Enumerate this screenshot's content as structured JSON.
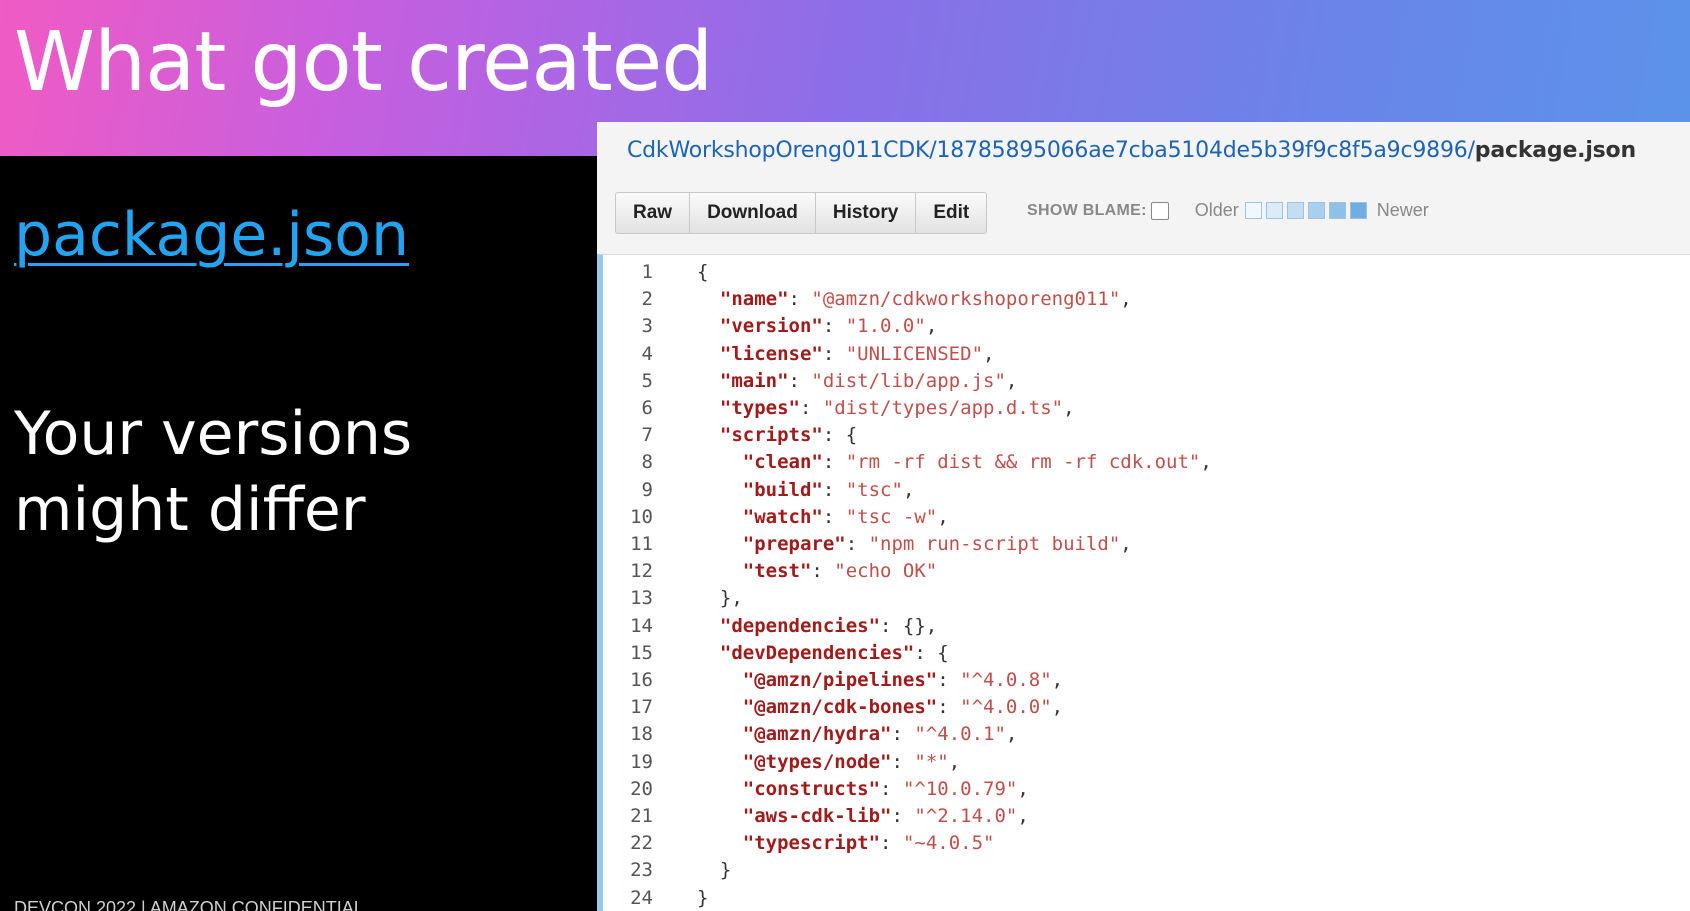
{
  "slide": {
    "title": "What got created",
    "link": "package.json",
    "note_line1": "Your versions",
    "note_line2": "might differ",
    "footer": "DEVCON 2022 | AMAZON CONFIDENTIAL"
  },
  "viewer": {
    "path_prefix": "CdkWorkshopOreng011CDK/18785895066ae7cba5104de5b39f9c8f5a9c9896/",
    "path_file": "package.json",
    "buttons": [
      "Raw",
      "Download",
      "History",
      "Edit"
    ],
    "show_blame_label": "SHOW BLAME:",
    "older_label": "Older",
    "newer_label": "Newer",
    "blame_swatch_colors": [
      "#f0f7fd",
      "#dcebf8",
      "#c3ddf3",
      "#a9cfee",
      "#8ec0e8",
      "#6faee2"
    ]
  },
  "code": [
    [
      {
        "t": "p",
        "v": "{"
      }
    ],
    [
      {
        "t": "p",
        "v": "  "
      },
      {
        "t": "k",
        "v": "\"name\""
      },
      {
        "t": "p",
        "v": ": "
      },
      {
        "t": "s",
        "v": "\"@amzn/cdkworkshoporeng011\""
      },
      {
        "t": "p",
        "v": ","
      }
    ],
    [
      {
        "t": "p",
        "v": "  "
      },
      {
        "t": "k",
        "v": "\"version\""
      },
      {
        "t": "p",
        "v": ": "
      },
      {
        "t": "s",
        "v": "\"1.0.0\""
      },
      {
        "t": "p",
        "v": ","
      }
    ],
    [
      {
        "t": "p",
        "v": "  "
      },
      {
        "t": "k",
        "v": "\"license\""
      },
      {
        "t": "p",
        "v": ": "
      },
      {
        "t": "s",
        "v": "\"UNLICENSED\""
      },
      {
        "t": "p",
        "v": ","
      }
    ],
    [
      {
        "t": "p",
        "v": "  "
      },
      {
        "t": "k",
        "v": "\"main\""
      },
      {
        "t": "p",
        "v": ": "
      },
      {
        "t": "s",
        "v": "\"dist/lib/app.js\""
      },
      {
        "t": "p",
        "v": ","
      }
    ],
    [
      {
        "t": "p",
        "v": "  "
      },
      {
        "t": "k",
        "v": "\"types\""
      },
      {
        "t": "p",
        "v": ": "
      },
      {
        "t": "s",
        "v": "\"dist/types/app.d.ts\""
      },
      {
        "t": "p",
        "v": ","
      }
    ],
    [
      {
        "t": "p",
        "v": "  "
      },
      {
        "t": "k",
        "v": "\"scripts\""
      },
      {
        "t": "p",
        "v": ": {"
      }
    ],
    [
      {
        "t": "p",
        "v": "    "
      },
      {
        "t": "k",
        "v": "\"clean\""
      },
      {
        "t": "p",
        "v": ": "
      },
      {
        "t": "s",
        "v": "\"rm -rf dist && rm -rf cdk.out\""
      },
      {
        "t": "p",
        "v": ","
      }
    ],
    [
      {
        "t": "p",
        "v": "    "
      },
      {
        "t": "k",
        "v": "\"build\""
      },
      {
        "t": "p",
        "v": ": "
      },
      {
        "t": "s",
        "v": "\"tsc\""
      },
      {
        "t": "p",
        "v": ","
      }
    ],
    [
      {
        "t": "p",
        "v": "    "
      },
      {
        "t": "k",
        "v": "\"watch\""
      },
      {
        "t": "p",
        "v": ": "
      },
      {
        "t": "s",
        "v": "\"tsc -w\""
      },
      {
        "t": "p",
        "v": ","
      }
    ],
    [
      {
        "t": "p",
        "v": "    "
      },
      {
        "t": "k",
        "v": "\"prepare\""
      },
      {
        "t": "p",
        "v": ": "
      },
      {
        "t": "s",
        "v": "\"npm run-script build\""
      },
      {
        "t": "p",
        "v": ","
      }
    ],
    [
      {
        "t": "p",
        "v": "    "
      },
      {
        "t": "k",
        "v": "\"test\""
      },
      {
        "t": "p",
        "v": ": "
      },
      {
        "t": "s",
        "v": "\"echo OK\""
      }
    ],
    [
      {
        "t": "p",
        "v": "  },"
      }
    ],
    [
      {
        "t": "p",
        "v": "  "
      },
      {
        "t": "k",
        "v": "\"dependencies\""
      },
      {
        "t": "p",
        "v": ": {},"
      }
    ],
    [
      {
        "t": "p",
        "v": "  "
      },
      {
        "t": "k",
        "v": "\"devDependencies\""
      },
      {
        "t": "p",
        "v": ": {"
      }
    ],
    [
      {
        "t": "p",
        "v": "    "
      },
      {
        "t": "k",
        "v": "\"@amzn/pipelines\""
      },
      {
        "t": "p",
        "v": ": "
      },
      {
        "t": "s",
        "v": "\"^4.0.8\""
      },
      {
        "t": "p",
        "v": ","
      }
    ],
    [
      {
        "t": "p",
        "v": "    "
      },
      {
        "t": "k",
        "v": "\"@amzn/cdk-bones\""
      },
      {
        "t": "p",
        "v": ": "
      },
      {
        "t": "s",
        "v": "\"^4.0.0\""
      },
      {
        "t": "p",
        "v": ","
      }
    ],
    [
      {
        "t": "p",
        "v": "    "
      },
      {
        "t": "k",
        "v": "\"@amzn/hydra\""
      },
      {
        "t": "p",
        "v": ": "
      },
      {
        "t": "s",
        "v": "\"^4.0.1\""
      },
      {
        "t": "p",
        "v": ","
      }
    ],
    [
      {
        "t": "p",
        "v": "    "
      },
      {
        "t": "k",
        "v": "\"@types/node\""
      },
      {
        "t": "p",
        "v": ": "
      },
      {
        "t": "s",
        "v": "\"*\""
      },
      {
        "t": "p",
        "v": ","
      }
    ],
    [
      {
        "t": "p",
        "v": "    "
      },
      {
        "t": "k",
        "v": "\"constructs\""
      },
      {
        "t": "p",
        "v": ": "
      },
      {
        "t": "s",
        "v": "\"^10.0.79\""
      },
      {
        "t": "p",
        "v": ","
      }
    ],
    [
      {
        "t": "p",
        "v": "    "
      },
      {
        "t": "k",
        "v": "\"aws-cdk-lib\""
      },
      {
        "t": "p",
        "v": ": "
      },
      {
        "t": "s",
        "v": "\"^2.14.0\""
      },
      {
        "t": "p",
        "v": ","
      }
    ],
    [
      {
        "t": "p",
        "v": "    "
      },
      {
        "t": "k",
        "v": "\"typescript\""
      },
      {
        "t": "p",
        "v": ": "
      },
      {
        "t": "s",
        "v": "\"~4.0.5\""
      }
    ],
    [
      {
        "t": "p",
        "v": "  }"
      }
    ],
    [
      {
        "t": "p",
        "v": "}"
      }
    ]
  ]
}
